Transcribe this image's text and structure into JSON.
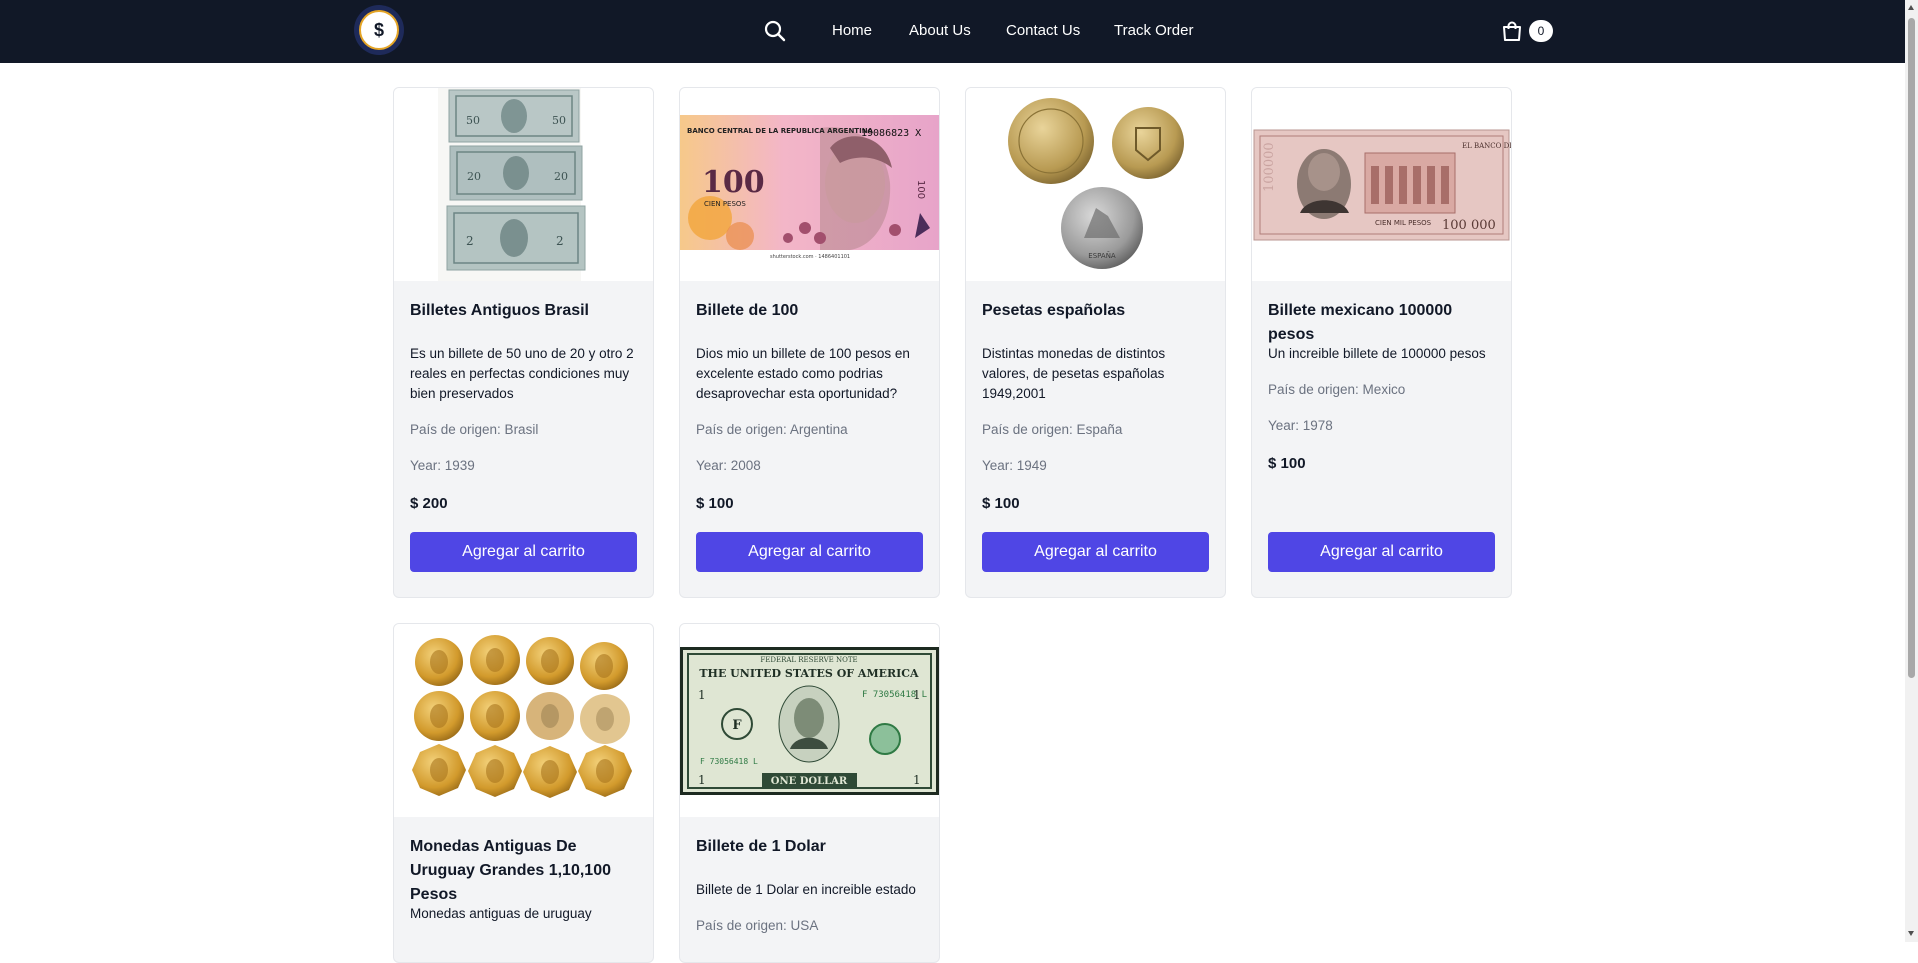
{
  "header": {
    "logo_text": "$",
    "nav": [
      {
        "label": "Home"
      },
      {
        "label": "About Us"
      },
      {
        "label": "Contact Us"
      },
      {
        "label": "Track Order"
      }
    ],
    "cart_count": "0"
  },
  "products": [
    {
      "title": "Billetes Antiguos Brasil",
      "description": "Es un billete de 50 uno de 20 y otro 2 reales en perfectas condiciones muy bien preservados",
      "country": "País de origen: Brasil",
      "year": "Year: 1939",
      "price": "$ 200",
      "button": "Agregar al carrito",
      "note_values": [
        "50",
        "20",
        "2"
      ]
    },
    {
      "title": "Billete de 100",
      "description": "Dios mio un billete de 100 pesos en excelente estado como podrias desaprovechar esta oportunidad?",
      "country": "País de origen: Argentina",
      "year": "Year: 2008",
      "price": "$ 100",
      "button": "Agregar al carrito",
      "note_bank": "BANCO CENTRAL DE LA REPUBLICA ARGENTINA",
      "note_serial": "19086823 X",
      "note_value": "100",
      "note_words": "CIEN PESOS",
      "note_credit": "shutterstock.com · 1486401101"
    },
    {
      "title": "Pesetas españolas",
      "description": "Distintas monedas de distintos valores, de pesetas españolas 1949,2001",
      "country": "País de origen: España",
      "year": "Year: 1949",
      "price": "$ 100",
      "button": "Agregar al carrito",
      "coin_text": "ESPAÑA"
    },
    {
      "title": "Billete mexicano 100000 pesos",
      "description": "Un increible billete de 100000 pesos",
      "country": "País de origen: Mexico",
      "year": "Year: 1978",
      "price": "$ 100",
      "button": "Agregar al carrito",
      "note_bank": "EL BANCO DE MEXICO",
      "note_value": "100000",
      "note_value_right": "100 000",
      "note_words": "CIEN MIL PESOS"
    },
    {
      "title": "Monedas Antiguas De Uruguay Grandes 1,10,100 Pesos",
      "description": "Monedas antiguas de uruguay"
    },
    {
      "title": "Billete de 1 Dolar",
      "description": "Billete de 1 Dolar en increible estado",
      "country": "País de origen: USA",
      "note_top": "FEDERAL RESERVE NOTE",
      "note_country": "THE UNITED STATES OF AMERICA",
      "note_serial": "F 73056418 L",
      "note_seal": "F",
      "note_value": "1",
      "note_words": "ONE DOLLAR"
    }
  ],
  "colors": {
    "navbar": "#111827",
    "button": "#4f46e5",
    "card_bg": "#f3f4f6",
    "logo_ring": "#e5a526"
  }
}
